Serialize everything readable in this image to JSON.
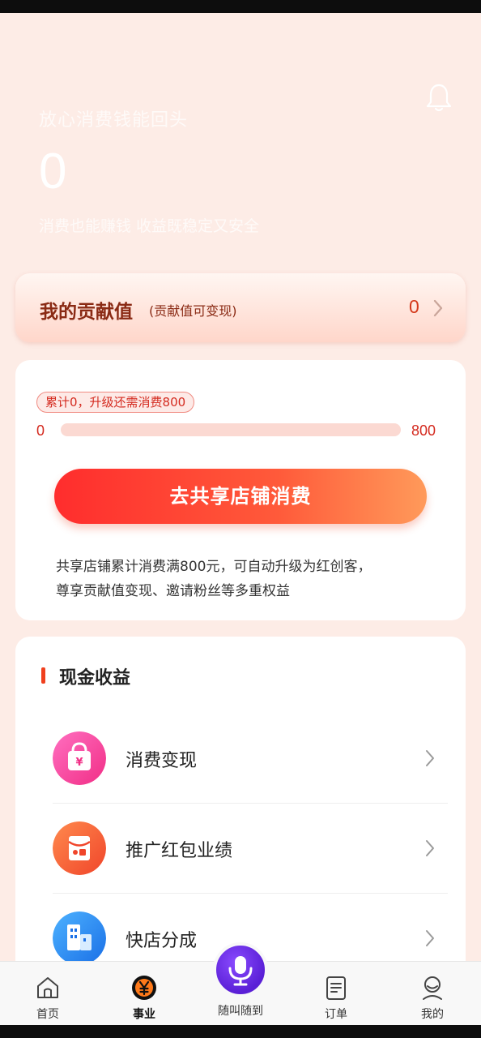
{
  "hero": {
    "slogan": "放心消费钱能回头",
    "value": "0",
    "description": "消费也能赚钱 收益既稳定又安全"
  },
  "contribution": {
    "title": "我的贡献值",
    "subtitle": "(贡献值可变现)",
    "value": "0"
  },
  "upgrade": {
    "badge": "累计0，升级还需消费800",
    "progress_min": "0",
    "progress_max": "800",
    "progress_fraction": 0,
    "cta_label": "去共享店铺消费",
    "note_line1": "共享店铺累计消费满800元，可自动升级为红创客，",
    "note_line2": "尊享贡献值变现、邀请粉丝等多重权益"
  },
  "cash": {
    "title": "现金收益",
    "items": [
      {
        "label": "消费变现",
        "icon": "shopping-bag-yuan-icon"
      },
      {
        "label": "推广红包业绩",
        "icon": "red-envelope-icon"
      },
      {
        "label": "快店分成",
        "icon": "buildings-icon"
      }
    ]
  },
  "tabbar": {
    "home": "首页",
    "business": "事业",
    "voice": "随叫随到",
    "orders": "订单",
    "mine": "我的"
  },
  "colors": {
    "accent": "#f03a2c",
    "background": "#fdece6",
    "voice": "#5a1fd6"
  }
}
